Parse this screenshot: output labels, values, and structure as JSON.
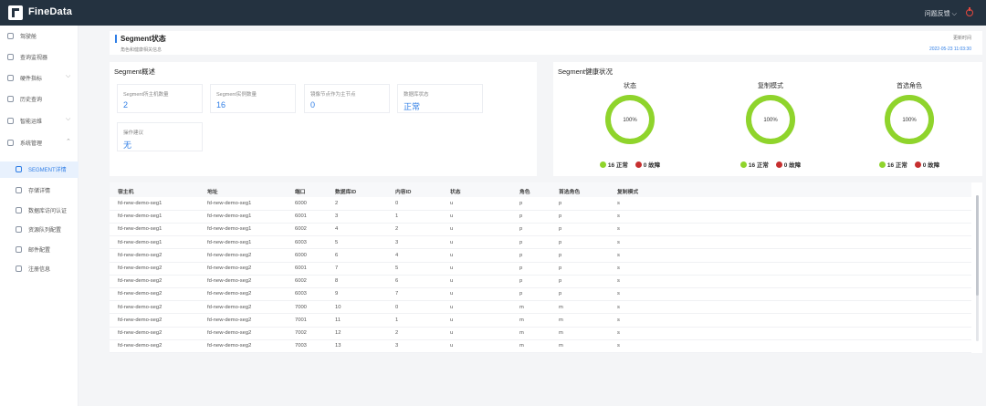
{
  "app": {
    "name": "FineData",
    "feedback": "问题反馈 ⌵"
  },
  "sidebar": {
    "items": [
      {
        "label": "驾驶舱",
        "icon": "dashboard-icon"
      },
      {
        "label": "查询监视器",
        "icon": "monitor-icon"
      },
      {
        "label": "硬件指标",
        "icon": "hardware-icon",
        "chev": "⌵"
      },
      {
        "label": "历史查询",
        "icon": "history-icon"
      },
      {
        "label": "智能运维",
        "icon": "ops-icon",
        "chev": "⌵"
      },
      {
        "label": "系统管理",
        "icon": "gear-icon",
        "chev": "⌃"
      }
    ],
    "subitems": [
      {
        "label": "SEGMENT详情",
        "icon": "segment-icon"
      },
      {
        "label": "存储详情",
        "icon": "storage-icon"
      },
      {
        "label": "数据库访问认证",
        "icon": "auth-icon"
      },
      {
        "label": "资源队列配置",
        "icon": "queue-icon"
      },
      {
        "label": "邮件配置",
        "icon": "mail-icon"
      },
      {
        "label": "注册信息",
        "icon": "register-icon"
      }
    ]
  },
  "header": {
    "title": "Segment状态",
    "subtitle": "角色和健康相关信息",
    "refresh_label": "更新时间",
    "refresh_time": "2022-05-23 11:03:30"
  },
  "overview": {
    "title": "Segment概述",
    "stats": [
      {
        "label": "Segment所主机数量",
        "value": "2"
      },
      {
        "label": "Segment实例数量",
        "value": "16"
      },
      {
        "label": "镜像节点作为主节点",
        "value": "0"
      },
      {
        "label": "数据库状态",
        "value": "正常"
      },
      {
        "label": "操作建议",
        "value": "无"
      }
    ]
  },
  "health": {
    "title": "Segment健康状况",
    "gauges": [
      {
        "title": "状态",
        "percent_label": "100%",
        "fraction": 1.0,
        "normal_label": "16 正常",
        "fault_label": "0 故障"
      },
      {
        "title": "复制模式",
        "percent_label": "100%",
        "fraction": 1.0,
        "normal_label": "16 正常",
        "fault_label": "0 故障"
      },
      {
        "title": "首选角色",
        "percent_label": "100%",
        "fraction": 1.0,
        "normal_label": "16 正常",
        "fault_label": "0 故障"
      }
    ],
    "colors": {
      "normal": "#8fd42c",
      "fault": "#c62f2f",
      "track": "#e9f6d8"
    }
  },
  "table": {
    "headers": [
      "宿主机",
      "地址",
      "端口",
      "数据库ID",
      "内容ID",
      "状态",
      "角色",
      "首选角色",
      "复制模式"
    ],
    "rows": [
      [
        "fd-new-demo-seg1",
        "fd-new-demo-seg1",
        "6000",
        "2",
        "0",
        "u",
        "p",
        "p",
        "s"
      ],
      [
        "fd-new-demo-seg1",
        "fd-new-demo-seg1",
        "6001",
        "3",
        "1",
        "u",
        "p",
        "p",
        "s"
      ],
      [
        "fd-new-demo-seg1",
        "fd-new-demo-seg1",
        "6002",
        "4",
        "2",
        "u",
        "p",
        "p",
        "s"
      ],
      [
        "fd-new-demo-seg1",
        "fd-new-demo-seg1",
        "6003",
        "5",
        "3",
        "u",
        "p",
        "p",
        "s"
      ],
      [
        "fd-new-demo-seg2",
        "fd-new-demo-seg2",
        "6000",
        "6",
        "4",
        "u",
        "p",
        "p",
        "s"
      ],
      [
        "fd-new-demo-seg2",
        "fd-new-demo-seg2",
        "6001",
        "7",
        "5",
        "u",
        "p",
        "p",
        "s"
      ],
      [
        "fd-new-demo-seg2",
        "fd-new-demo-seg2",
        "6002",
        "8",
        "6",
        "u",
        "p",
        "p",
        "s"
      ],
      [
        "fd-new-demo-seg2",
        "fd-new-demo-seg2",
        "6003",
        "9",
        "7",
        "u",
        "p",
        "p",
        "s"
      ],
      [
        "fd-new-demo-seg2",
        "fd-new-demo-seg2",
        "7000",
        "10",
        "0",
        "u",
        "m",
        "m",
        "s"
      ],
      [
        "fd-new-demo-seg2",
        "fd-new-demo-seg2",
        "7001",
        "11",
        "1",
        "u",
        "m",
        "m",
        "s"
      ],
      [
        "fd-new-demo-seg2",
        "fd-new-demo-seg2",
        "7002",
        "12",
        "2",
        "u",
        "m",
        "m",
        "s"
      ],
      [
        "fd-new-demo-seg2",
        "fd-new-demo-seg2",
        "7003",
        "13",
        "3",
        "u",
        "m",
        "m",
        "s"
      ]
    ]
  }
}
